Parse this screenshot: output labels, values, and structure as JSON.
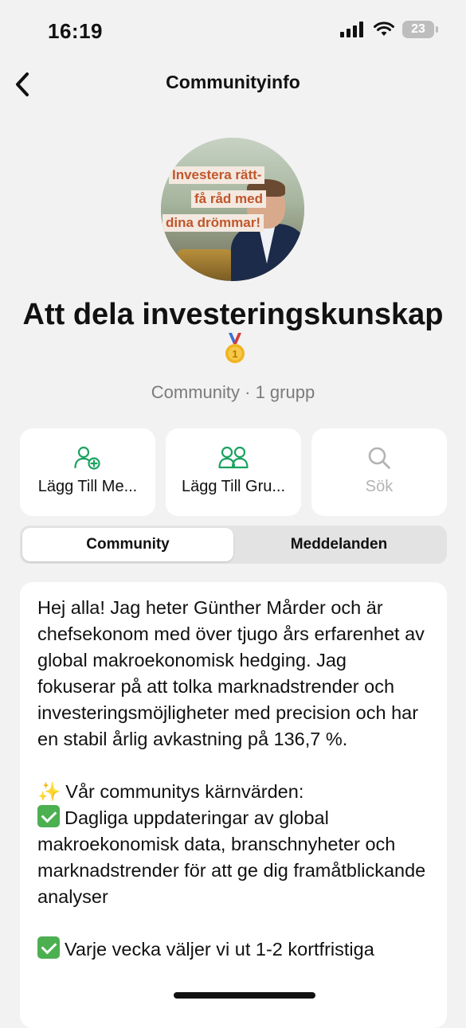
{
  "status_bar": {
    "time": "16:19",
    "battery": "23"
  },
  "nav": {
    "title": "Communityinfo"
  },
  "avatar": {
    "tag_line1": "Investera rätt-",
    "tag_line2": "få råd med",
    "tag_line3": "dina drömmar!"
  },
  "group": {
    "title": "Att dela investeringskunskap",
    "subtitle": "Community · 1 grupp"
  },
  "actions": [
    {
      "label": "Lägg Till Me...",
      "icon": "add-member-icon",
      "color": "#1aa260"
    },
    {
      "label": "Lägg Till Gru...",
      "icon": "add-group-icon",
      "color": "#1aa260"
    },
    {
      "label": "Sök",
      "icon": "search-icon",
      "color": "#b3b3b3"
    }
  ],
  "tabs": [
    {
      "label": "Community",
      "active": true
    },
    {
      "label": "Meddelanden",
      "active": false
    }
  ],
  "description": {
    "para1": "Hej alla! Jag heter Günther Mårder och är chefsekonom med över tjugo års erfarenhet av global makroekonomisk hedging. Jag fokuserar på att tolka marknadstrender och investeringsmöjligheter med precision och har en stabil årlig avkastning på 136,7 %.",
    "values_heading": "Vår communitys kärnvärden:",
    "value1": "Dagliga uppdateringar av global makroekonomisk data, branschnyheter och marknadstrender för att ge dig framåtblickande analyser",
    "value2": "Varje vecka väljer vi ut 1-2 kortfristiga"
  },
  "colors": {
    "accent_green": "#1aa260",
    "background": "#f2f2f2"
  }
}
